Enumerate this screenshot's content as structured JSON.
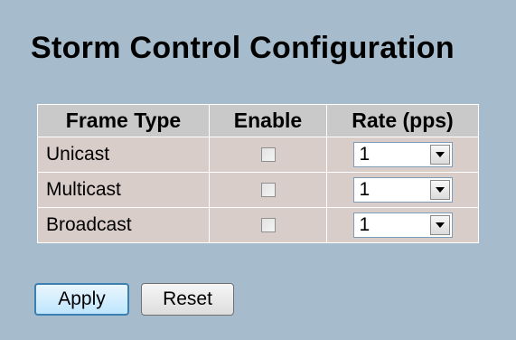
{
  "page": {
    "title": "Storm Control Configuration"
  },
  "table": {
    "headers": {
      "frame_type": "Frame Type",
      "enable": "Enable",
      "rate": "Rate (pps)"
    },
    "rows": [
      {
        "frame_type": "Unicast",
        "enabled": false,
        "rate": "1"
      },
      {
        "frame_type": "Multicast",
        "enabled": false,
        "rate": "1"
      },
      {
        "frame_type": "Broadcast",
        "enabled": false,
        "rate": "1"
      }
    ]
  },
  "buttons": {
    "apply": "Apply",
    "reset": "Reset"
  },
  "icons": {
    "dropdown": "chevron-down-icon"
  },
  "colors": {
    "page_background": "#a6bccd",
    "header_background": "#c9c9c9",
    "row_background": "#d9cdca",
    "apply_border": "#3c7fb1"
  }
}
